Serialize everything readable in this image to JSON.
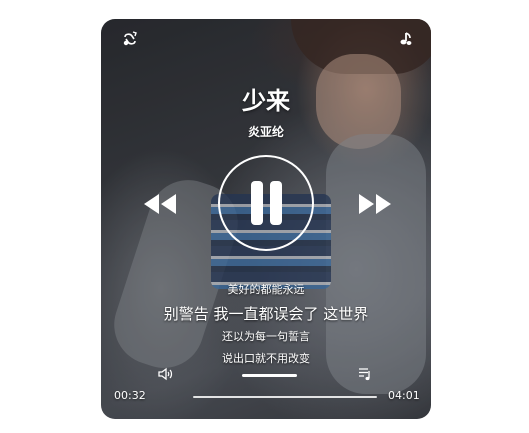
{
  "song": {
    "title": "少来",
    "artist": "炎亚纶"
  },
  "lyrics": {
    "previous": "美好的都能永远",
    "current": "别警告 我一直都误会了 这世界",
    "next_1": "还以为每一句誓言",
    "next_2": "说出口就不用改变"
  },
  "playback": {
    "elapsed": "00:32",
    "duration": "04:01",
    "progress": 0.0,
    "state": "playing"
  },
  "icons": {
    "top_left": "loop-mode-icon",
    "top_right": "music-note-icon",
    "prev": "rewind-icon",
    "next": "fast-forward-icon",
    "volume": "volume-icon",
    "playlist": "playlist-icon"
  },
  "colors": {
    "foreground": "#ffffff"
  }
}
